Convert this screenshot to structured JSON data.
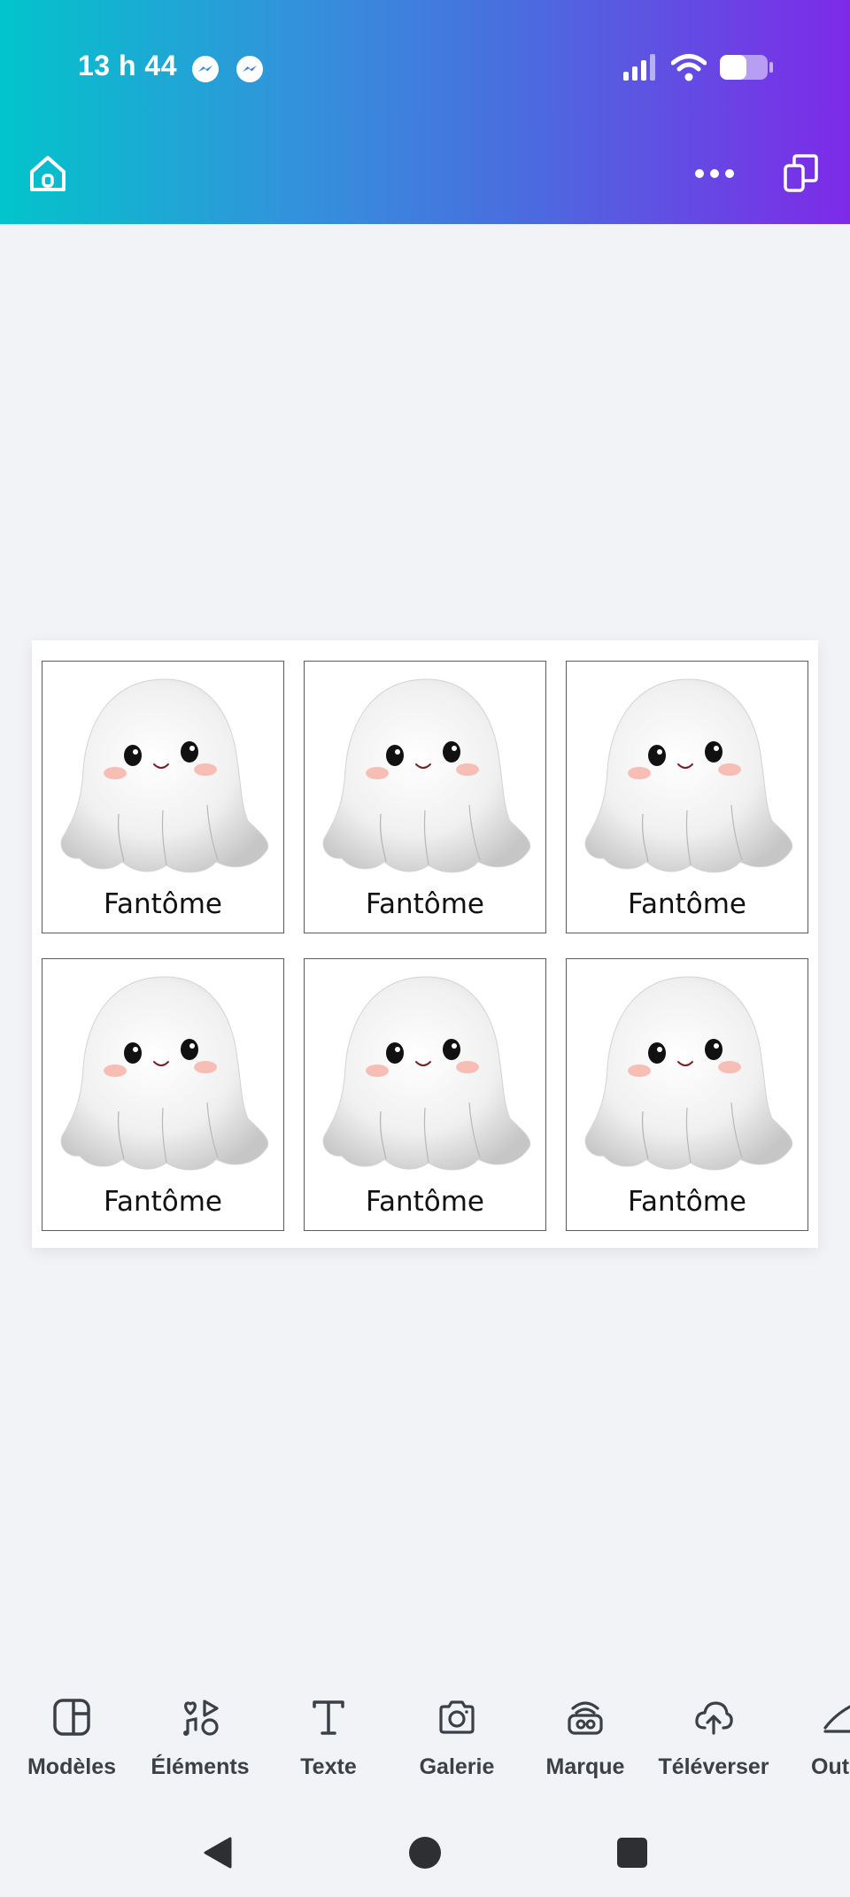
{
  "status_bar": {
    "time": "13 h 44",
    "notification_icons": [
      "messenger-icon",
      "messenger-icon"
    ],
    "right_icons": [
      "signal-icon",
      "wifi-icon",
      "battery-icon"
    ]
  },
  "header": {
    "left_icon": "home-icon",
    "right_icons": [
      "more-icon",
      "pages-icon"
    ]
  },
  "design": {
    "cards": [
      {
        "label": "Fantôme"
      },
      {
        "label": "Fantôme"
      },
      {
        "label": "Fantôme"
      },
      {
        "label": "Fantôme"
      },
      {
        "label": "Fantôme"
      },
      {
        "label": "Fantôme"
      }
    ]
  },
  "toolbar": {
    "items": [
      {
        "label": "Modèles",
        "icon": "templates-icon"
      },
      {
        "label": "Éléments",
        "icon": "elements-icon"
      },
      {
        "label": "Texte",
        "icon": "text-icon"
      },
      {
        "label": "Galerie",
        "icon": "camera-icon"
      },
      {
        "label": "Marque",
        "icon": "brand-icon"
      },
      {
        "label": "Téléverser",
        "icon": "upload-icon"
      },
      {
        "label": "Out",
        "icon": "tools-icon"
      }
    ]
  },
  "nav": {
    "buttons": [
      "back-icon",
      "home-circle-icon",
      "recents-icon"
    ]
  },
  "colors": {
    "gradient_start": "#02c4cb",
    "gradient_end": "#7d2ae8",
    "background": "#f2f3f7",
    "toolbar_text": "#3b3f46"
  }
}
